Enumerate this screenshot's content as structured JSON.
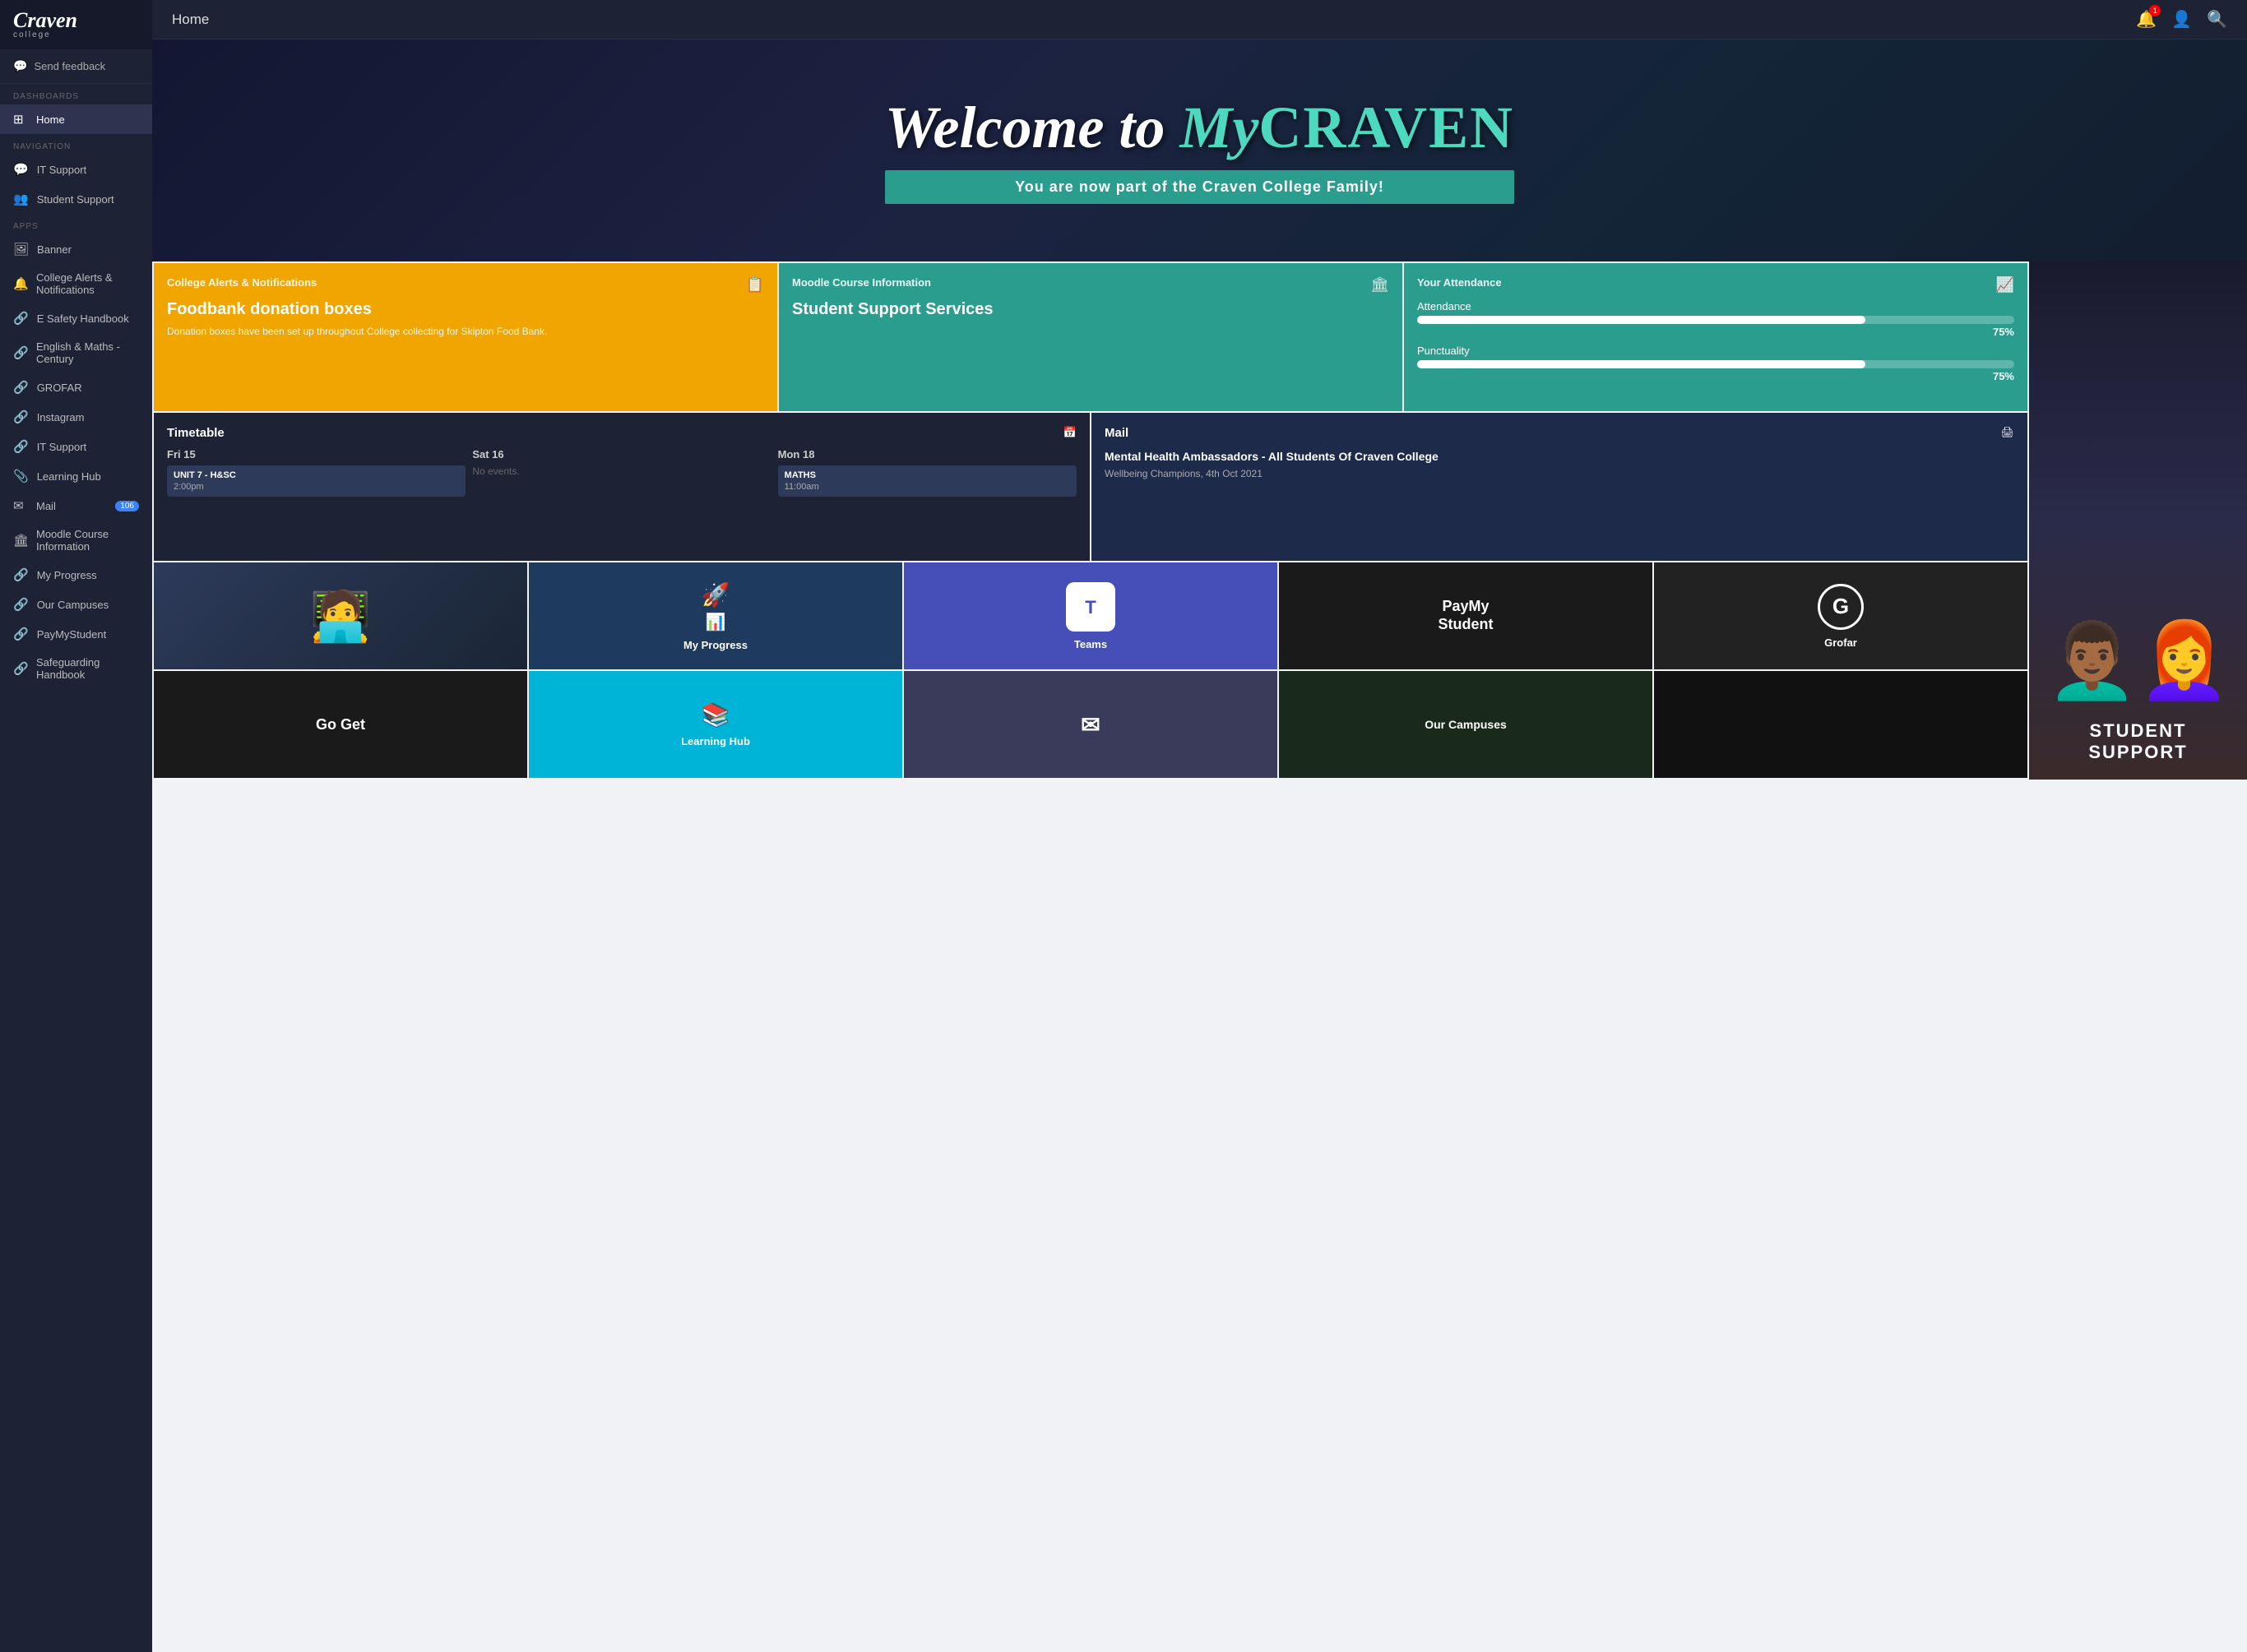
{
  "sidebar": {
    "logo_main": "Craven",
    "logo_sub": "college",
    "feedback_label": "Send feedback",
    "sections": [
      {
        "label": "DASHBOARDS",
        "items": [
          {
            "id": "home",
            "label": "Home",
            "icon": "⊞",
            "active": true
          }
        ]
      },
      {
        "label": "NAVIGATION",
        "items": [
          {
            "id": "it-support",
            "label": "IT Support",
            "icon": "💬"
          },
          {
            "id": "student-support",
            "label": "Student Support",
            "icon": "👥"
          }
        ]
      },
      {
        "label": "APPS",
        "items": [
          {
            "id": "banner",
            "label": "Banner",
            "icon": "🖼"
          },
          {
            "id": "college-alerts",
            "label": "College Alerts & Notifications",
            "icon": "🔔"
          },
          {
            "id": "e-safety",
            "label": "E Safety Handbook",
            "icon": "🔗"
          },
          {
            "id": "english-maths",
            "label": "English & Maths - Century",
            "icon": "🔗"
          },
          {
            "id": "grofar",
            "label": "GROFAR",
            "icon": "🔗"
          },
          {
            "id": "instagram",
            "label": "Instagram",
            "icon": "🔗"
          },
          {
            "id": "it-support2",
            "label": "IT Support",
            "icon": "🔗"
          },
          {
            "id": "learning-hub",
            "label": "Learning Hub",
            "icon": "📎"
          },
          {
            "id": "mail",
            "label": "Mail",
            "icon": "✉",
            "badge": "106"
          },
          {
            "id": "moodle",
            "label": "Moodle Course Information",
            "icon": "🏛"
          },
          {
            "id": "my-progress",
            "label": "My Progress",
            "icon": "🔗"
          },
          {
            "id": "our-campuses",
            "label": "Our Campuses",
            "icon": "🔗"
          },
          {
            "id": "paymystudent",
            "label": "PayMyStudent",
            "icon": "🔗"
          },
          {
            "id": "safeguarding",
            "label": "Safeguarding Handbook",
            "icon": "🔗"
          }
        ]
      }
    ]
  },
  "topbar": {
    "title": "Home",
    "notification_count": "1"
  },
  "hero": {
    "welcome_text": "Welcome to",
    "my_text": "My",
    "craven_text": "CRAVEN",
    "subtitle": "You are now part of the Craven College Family!"
  },
  "college_alerts": {
    "header": "College Alerts & Notifications",
    "title": "Foodbank donation boxes",
    "body": "Donation boxes have been set up throughout College collecting for Skipton Food Bank."
  },
  "moodle": {
    "header": "Moodle Course Information",
    "title": "Student Support Services"
  },
  "attendance": {
    "header": "Your Attendance",
    "attendance_label": "Attendance",
    "attendance_pct": "75%",
    "attendance_value": 75,
    "punctuality_label": "Punctuality",
    "punctuality_pct": "75%",
    "punctuality_value": 75
  },
  "timetable": {
    "header": "Timetable",
    "icon": "📅",
    "days": [
      {
        "label": "Fri 15",
        "event_name": "UNIT 7 - H&SC",
        "event_time": "2:00pm"
      },
      {
        "label": "Sat 16",
        "event_name": "",
        "event_time": "",
        "no_events": "No events."
      },
      {
        "label": "Mon 18",
        "event_name": "MATHS",
        "event_time": "11:00am"
      }
    ]
  },
  "mail": {
    "header": "Mail",
    "icon": "🖨",
    "subject": "Mental Health Ambassadors - All Students Of Craven College",
    "preview": "Wellbeing Champions, 4th Oct 2021"
  },
  "apps": [
    {
      "id": "my-progress-tile",
      "label": "My Progress",
      "icon": "rocket",
      "bg": "#1e3a5f"
    },
    {
      "id": "teams-tile",
      "label": "Teams",
      "icon": "teams",
      "bg": "#464EB8"
    },
    {
      "id": "paymystudent-tile",
      "label": "PayMy Student",
      "icon": "pay",
      "bg": "#1a1a1a"
    },
    {
      "id": "grofar-tile",
      "label": "Grofar",
      "icon": "grofar",
      "bg": "#222222"
    }
  ],
  "apps2": [
    {
      "id": "goget-tile",
      "label": "Go Get",
      "icon": "goget",
      "bg": "#1a1a1a"
    },
    {
      "id": "learning-hub-tile",
      "label": "Learning Hub",
      "icon": "hub",
      "bg": "#00b4d8"
    },
    {
      "id": "mail2-tile",
      "label": "Mail",
      "icon": "mail2",
      "bg": "#444444"
    },
    {
      "id": "ourcampuses-tile",
      "label": "Our Campuses",
      "icon": "campus",
      "bg": "#2a3a2a"
    }
  ],
  "student_support_label": "STUDENT SUPPORT",
  "colors": {
    "orange": "#f0a500",
    "teal": "#2a9d8f",
    "dark_blue": "#1e3a5f",
    "sidebar_bg": "#1e2235",
    "topbar_bg": "#1e2235"
  }
}
